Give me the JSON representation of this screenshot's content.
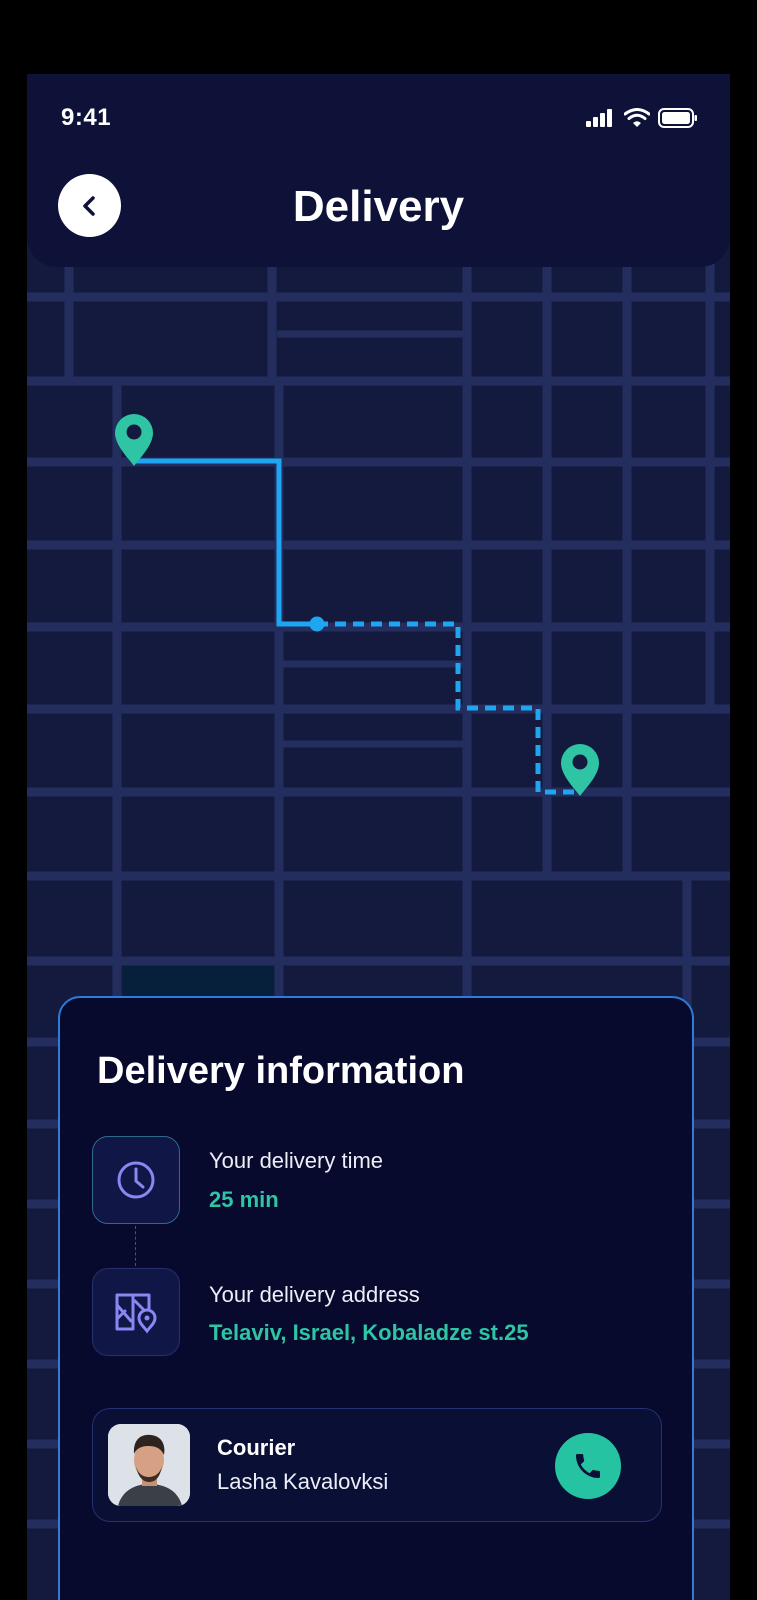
{
  "status_bar": {
    "time": "9:41"
  },
  "header": {
    "title": "Delivery"
  },
  "icons": {
    "back": "chevron-left-icon",
    "signal": "signal-icon",
    "wifi": "wifi-icon",
    "battery": "battery-icon",
    "start_pin": "location-pin-icon",
    "end_pin": "location-pin-icon",
    "clock": "clock-icon",
    "map": "map-location-icon",
    "phone": "phone-icon"
  },
  "delivery_info": {
    "title": "Delivery information",
    "time_label": "Your delivery time",
    "time_value": "25 min",
    "address_label": "Your delivery address",
    "address_value": "Telaviv, Israel, Kobaladze st.25"
  },
  "courier": {
    "role": "Courier",
    "name": "Lasha Kavalovksi"
  },
  "colors": {
    "background": "#131a3d",
    "header": "#0e1238",
    "card": "#070a2c",
    "accent_green": "#2ec4a4",
    "route_blue": "#1fa6f2",
    "card_border": "#2c7cd8"
  }
}
